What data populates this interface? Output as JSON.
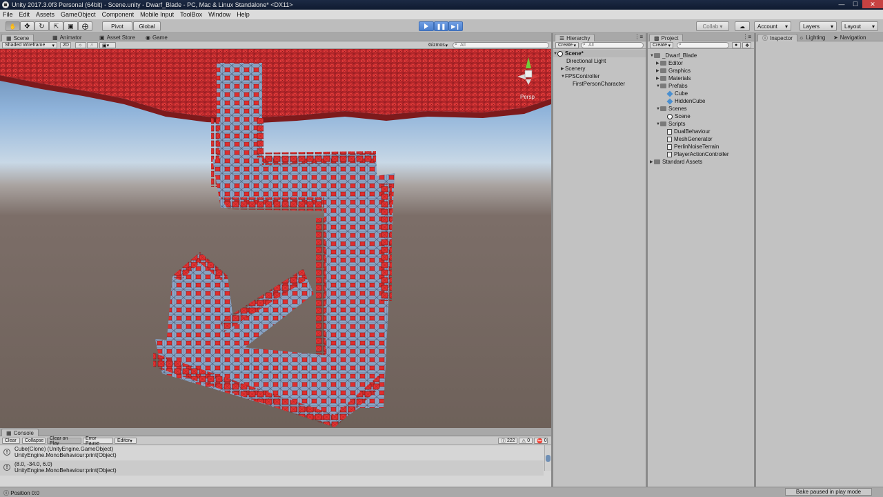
{
  "window": {
    "title": "Unity 2017.3.0f3 Personal (64bit) - Scene.unity - Dwarf_Blade - PC, Mac & Linux Standalone* <DX11>",
    "minimize": "—",
    "maximize": "☐",
    "close": "✕"
  },
  "menu": [
    "File",
    "Edit",
    "Assets",
    "GameObject",
    "Component",
    "Mobile Input",
    "ToolBox",
    "Window",
    "Help"
  ],
  "toolbar": {
    "pivot": "Pivot",
    "global": "Global",
    "collab": "Collab ▾",
    "account": "Account",
    "layers": "Layers",
    "layout": "Layout"
  },
  "scene_tabs": [
    "Scene",
    "Animator",
    "Asset Store",
    "Game"
  ],
  "scene_bar": {
    "shading": "Shaded Wireframe",
    "mode_2d": "2D",
    "gizmos": "Gizmos",
    "search_placeholder": "All"
  },
  "scene_view": {
    "projection": "Persp"
  },
  "hierarchy": {
    "tab": "Hierarchy",
    "create": "Create",
    "search_placeholder": "All",
    "scene": "Scene*",
    "items": [
      "Directional Light",
      "Scenery",
      "FPSController",
      "FirstPersonCharacter"
    ]
  },
  "project": {
    "tab": "Project",
    "create": "Create",
    "items": [
      "_Dwarf_Blade",
      "Editor",
      "Graphics",
      "Materials",
      "Prefabs",
      "Cube",
      "HiddenCube",
      "Scenes",
      "Scene",
      "Scripts",
      "DualBehaviour",
      "MeshGenerator",
      "PerlinNoiseTerrain",
      "PlayerActionController",
      "Standard Assets"
    ]
  },
  "inspector_tabs": [
    "Inspector",
    "Lighting",
    "Navigation"
  ],
  "console": {
    "tab": "Console",
    "buttons": [
      "Clear",
      "Collapse",
      "Clear on Play",
      "Error Pause",
      "Editor"
    ],
    "counts": {
      "log": "222",
      "warn": "0",
      "error": "0"
    },
    "logs": [
      {
        "line1": "Cube(Clone) (UnityEngine.GameObject)",
        "line2": "UnityEngine.MonoBehaviour:print(Object)"
      },
      {
        "line1": "(8.0, -34.0, 6.0)",
        "line2": "UnityEngine.MonoBehaviour:print(Object)"
      }
    ]
  },
  "status": {
    "left": "Position 0:0",
    "right": "Bake paused in play mode"
  },
  "colors": {
    "accent_play": "#4a7fce",
    "cube_red": "#e03030",
    "cube_blue": "#8ea8c8"
  }
}
